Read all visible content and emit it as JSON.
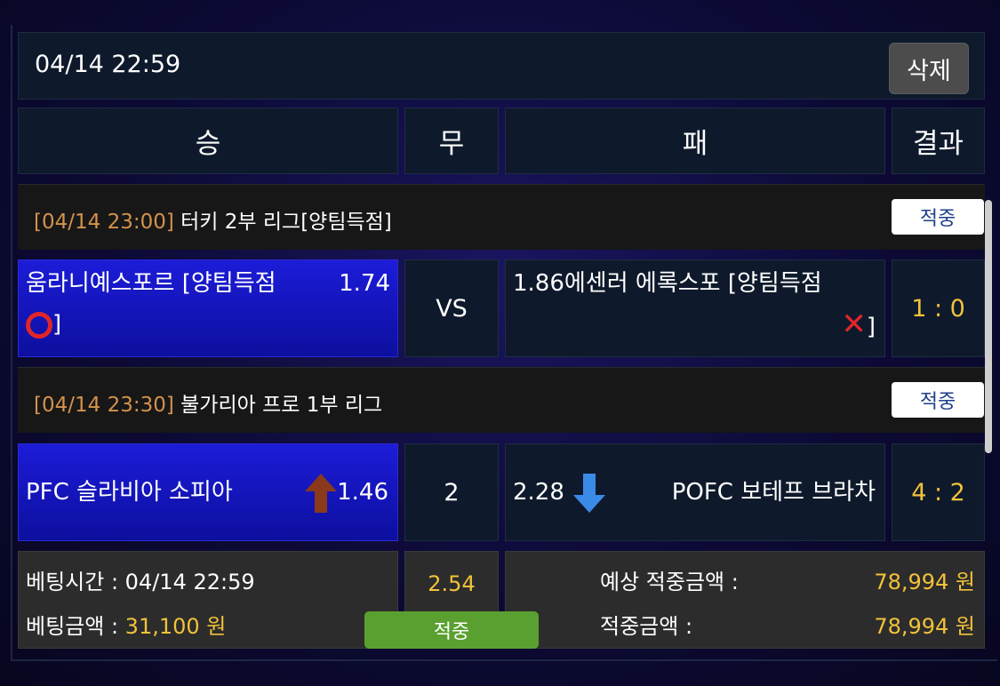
{
  "topbar": {
    "time": "04/14 22:59",
    "delete_label": "삭제"
  },
  "headers": {
    "win": "승",
    "draw": "무",
    "lose": "패",
    "result": "결과"
  },
  "matches": [
    {
      "league_date": "[04/14 23:00]",
      "league_name": "터키 2부 리그[양팀득점]",
      "badge": "적중",
      "home_line1": "움라니예스포르 [양팀득점",
      "home_odds": "1.74",
      "home_line2_suffix": "]",
      "home_mark": "⭕",
      "middle": "VS",
      "away_odds": "1.86",
      "away_line1": "에센러 에록스포 [양팀득점",
      "away_mark": "❌",
      "away_line2_suffix": "]",
      "score": "1 : 0"
    },
    {
      "league_date": "[04/14 23:30]",
      "league_name": "불가리아 프로 1부 리그",
      "badge": "적중",
      "home_team": "PFC 슬라비아 소피아",
      "home_odds": "1.46",
      "middle": "2",
      "away_odds": "2.28",
      "away_team": "POFC 보테프 브라차",
      "score": "4 : 2"
    }
  ],
  "summary": {
    "bet_time_label": "베팅시간 : ",
    "bet_time": "04/14 22:59",
    "bet_amount_label": "베팅금액 : ",
    "bet_amount": "31,100 원",
    "total_odds": "2.54",
    "status_button": "적중",
    "expected_label": "예상 적중금액 :",
    "expected_value": "78,994 원",
    "win_label": "적중금액 :",
    "win_value": "78,994 원"
  },
  "colors": {
    "accent_yellow": "#f2c23a",
    "league_date": "#d4924a",
    "win_cell": "#1515c0",
    "hit_green": "#5aa031",
    "up_arrow": "#8a3a1a",
    "down_arrow": "#3a8ae8"
  }
}
